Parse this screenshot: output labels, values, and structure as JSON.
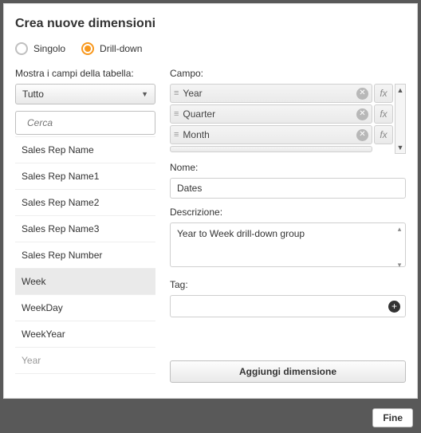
{
  "title": "Crea nuove dimensioni",
  "type_radio": {
    "single": "Singolo",
    "drilldown": "Drill-down",
    "selected": "drilldown"
  },
  "left": {
    "show_fields_label": "Mostra i campi della tabella:",
    "table_dropdown": "Tutto",
    "search_placeholder": "Cerca",
    "fields": [
      "Sales Rep Name",
      "Sales Rep Name1",
      "Sales Rep Name2",
      "Sales Rep Name3",
      "Sales Rep Number",
      "Week",
      "WeekDay",
      "WeekYear",
      "Year"
    ],
    "hover_index": 5,
    "fade_index": 8
  },
  "right": {
    "campo_label": "Campo:",
    "campo_items": [
      "Year",
      "Quarter",
      "Month"
    ],
    "fx_label": "fx",
    "nome_label": "Nome:",
    "nome_value": "Dates",
    "descr_label": "Descrizione:",
    "descr_value": "Year to Week drill-down group",
    "tag_label": "Tag:",
    "add_button": "Aggiungi dimensione"
  },
  "footer": {
    "fine": "Fine"
  }
}
